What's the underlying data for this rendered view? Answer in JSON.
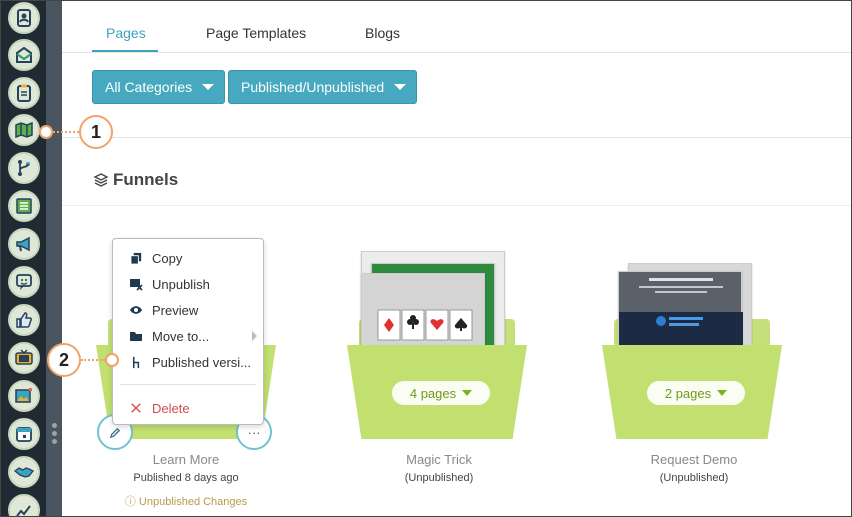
{
  "tabs": [
    {
      "label": "Pages",
      "active": true
    },
    {
      "label": "Page Templates",
      "active": false
    },
    {
      "label": "Blogs",
      "active": false
    }
  ],
  "filters": {
    "categories": "All Categories",
    "status": "Published/Unpublished"
  },
  "section": {
    "title": "Funnels"
  },
  "folders": [
    {
      "name": "Learn More",
      "status": "Published 8 days ago",
      "warning": "Unpublished Changes"
    },
    {
      "name": "Magic Trick",
      "status": "(Unpublished)",
      "pages": "4 pages"
    },
    {
      "name": "Request Demo",
      "status": "(Unpublished)",
      "pages": "2 pages"
    }
  ],
  "context_menu": {
    "items": [
      {
        "label": "Copy",
        "icon": "copy-icon"
      },
      {
        "label": "Unpublish",
        "icon": "unpublish-icon"
      },
      {
        "label": "Preview",
        "icon": "eye-icon"
      },
      {
        "label": "Move to...",
        "icon": "folder-icon"
      },
      {
        "label": "Published versi...",
        "icon": "version-icon"
      },
      {
        "label": "Delete",
        "icon": "close-icon"
      }
    ]
  },
  "callouts": [
    "1",
    "2"
  ],
  "more_label": "···",
  "colors": {
    "accent": "#3aa3bd",
    "button": "#46a9c0",
    "folder": "#c1e070",
    "callout": "#f0a36a",
    "danger": "#d24b4b",
    "warning": "#b89a4a"
  },
  "sidebar_icons": [
    "contacts-icon",
    "mail-icon",
    "clipboard-icon",
    "map-icon",
    "branch-icon",
    "list-icon",
    "megaphone-icon",
    "chat-icon",
    "thumbs-up-icon",
    "tv-icon",
    "image-icon",
    "calendar-icon",
    "handshake-icon",
    "chart-icon"
  ]
}
